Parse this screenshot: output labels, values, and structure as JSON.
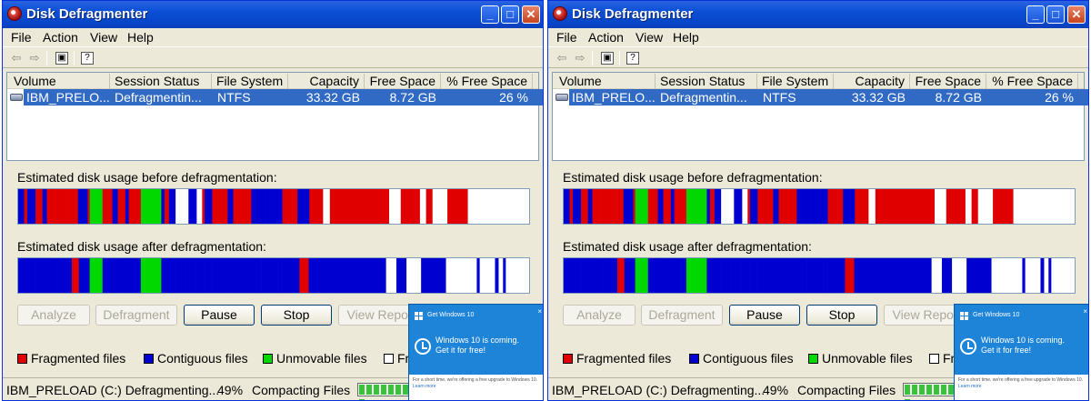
{
  "title": "Disk Defragmenter",
  "title_buttons": {
    "minimize": "_",
    "maximize": "□",
    "close": "✕"
  },
  "menu": [
    "File",
    "Action",
    "View",
    "Help"
  ],
  "toolbar_icons": [
    "back-arrow-icon",
    "forward-arrow-icon",
    "properties-icon",
    "help-icon"
  ],
  "toolbar_glyphs": {
    "back": "⇦",
    "forward": "⇨",
    "properties": "▣",
    "help": "?"
  },
  "columns": [
    "Volume",
    "Session Status",
    "File System",
    "Capacity",
    "Free Space",
    "% Free Space"
  ],
  "row": {
    "volume": "IBM_PRELO...",
    "status": "Defragmentin...",
    "fs": "NTFS",
    "capacity": "33.32 GB",
    "free": "8.72 GB",
    "pct": "26 %"
  },
  "before_label": "Estimated disk usage before defragmentation:",
  "after_label": "Estimated disk usage after defragmentation:",
  "buttons": {
    "analyze": "Analyze",
    "defragment": "Defragment",
    "pause": "Pause",
    "stop": "Stop",
    "report": "View Report"
  },
  "legend": {
    "fragmented": "Fragmented files",
    "contiguous": "Contiguous files",
    "unmovable": "Unmovable files",
    "free": "Free space"
  },
  "colors": {
    "fragmented": "#e00000",
    "contiguous": "#0000d0",
    "unmovable": "#00d800",
    "free": "#ffffff",
    "selection": "#316ac5",
    "toast": "#1e84d8"
  },
  "status": {
    "left": "IBM_PRELOAD (C:) Defragmenting...",
    "pct": "49%",
    "phase": "Compacting Files",
    "progress": 0.49
  },
  "toast": {
    "title": "Get Windows 10",
    "line1": "Windows 10 is coming.",
    "line2": "Get it for free!",
    "foot": "For a short time, we're offering a free upgrade to Windows 10.",
    "learn": "Learn more",
    "close": "×"
  }
}
